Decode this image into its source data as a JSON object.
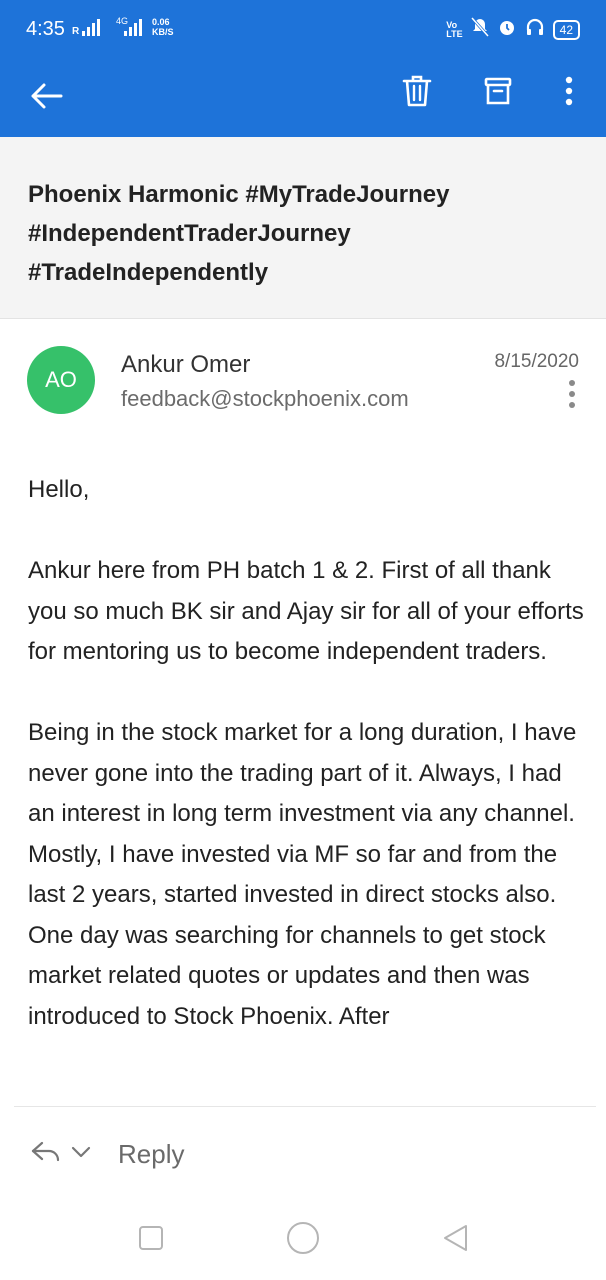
{
  "status_bar": {
    "time": "4:35",
    "signal_label": "R",
    "network": "4G",
    "speed_value": "0.06",
    "speed_unit": "KB/S",
    "volte_top": "Vo",
    "volte_bottom": "LTE",
    "battery": "42"
  },
  "toolbar": {
    "back_icon": "arrow-left-icon",
    "delete_icon": "trash-icon",
    "archive_icon": "archive-icon",
    "more_icon": "more-vertical-icon"
  },
  "email": {
    "subject": "Phoenix Harmonic #MyTradeJourney #IndependentTraderJourney #TradeIndependently",
    "sender": {
      "initials": "AO",
      "name": "Ankur Omer",
      "email": "feedback@stockphoenix.com",
      "avatar_color": "#36c16a"
    },
    "date": "8/15/2020",
    "body": [
      "Hello,",
      "Ankur here from PH batch 1 & 2. First of all thank you so much BK sir and Ajay sir for all of your efforts for mentoring us to become independent traders.",
      "Being in the stock market for a long duration, I have never gone into the trading part of it. Always, I had an interest in long term investment via any channel. Mostly, I have invested via MF so far and from the last 2 years, started invested in direct stocks also. One day was searching for channels to get stock market related quotes or updates and then was introduced to Stock Phoenix. After"
    ]
  },
  "reply": {
    "label": "Reply"
  },
  "colors": {
    "accent": "#1e73d9",
    "subject_band": "#f4f4f4"
  }
}
